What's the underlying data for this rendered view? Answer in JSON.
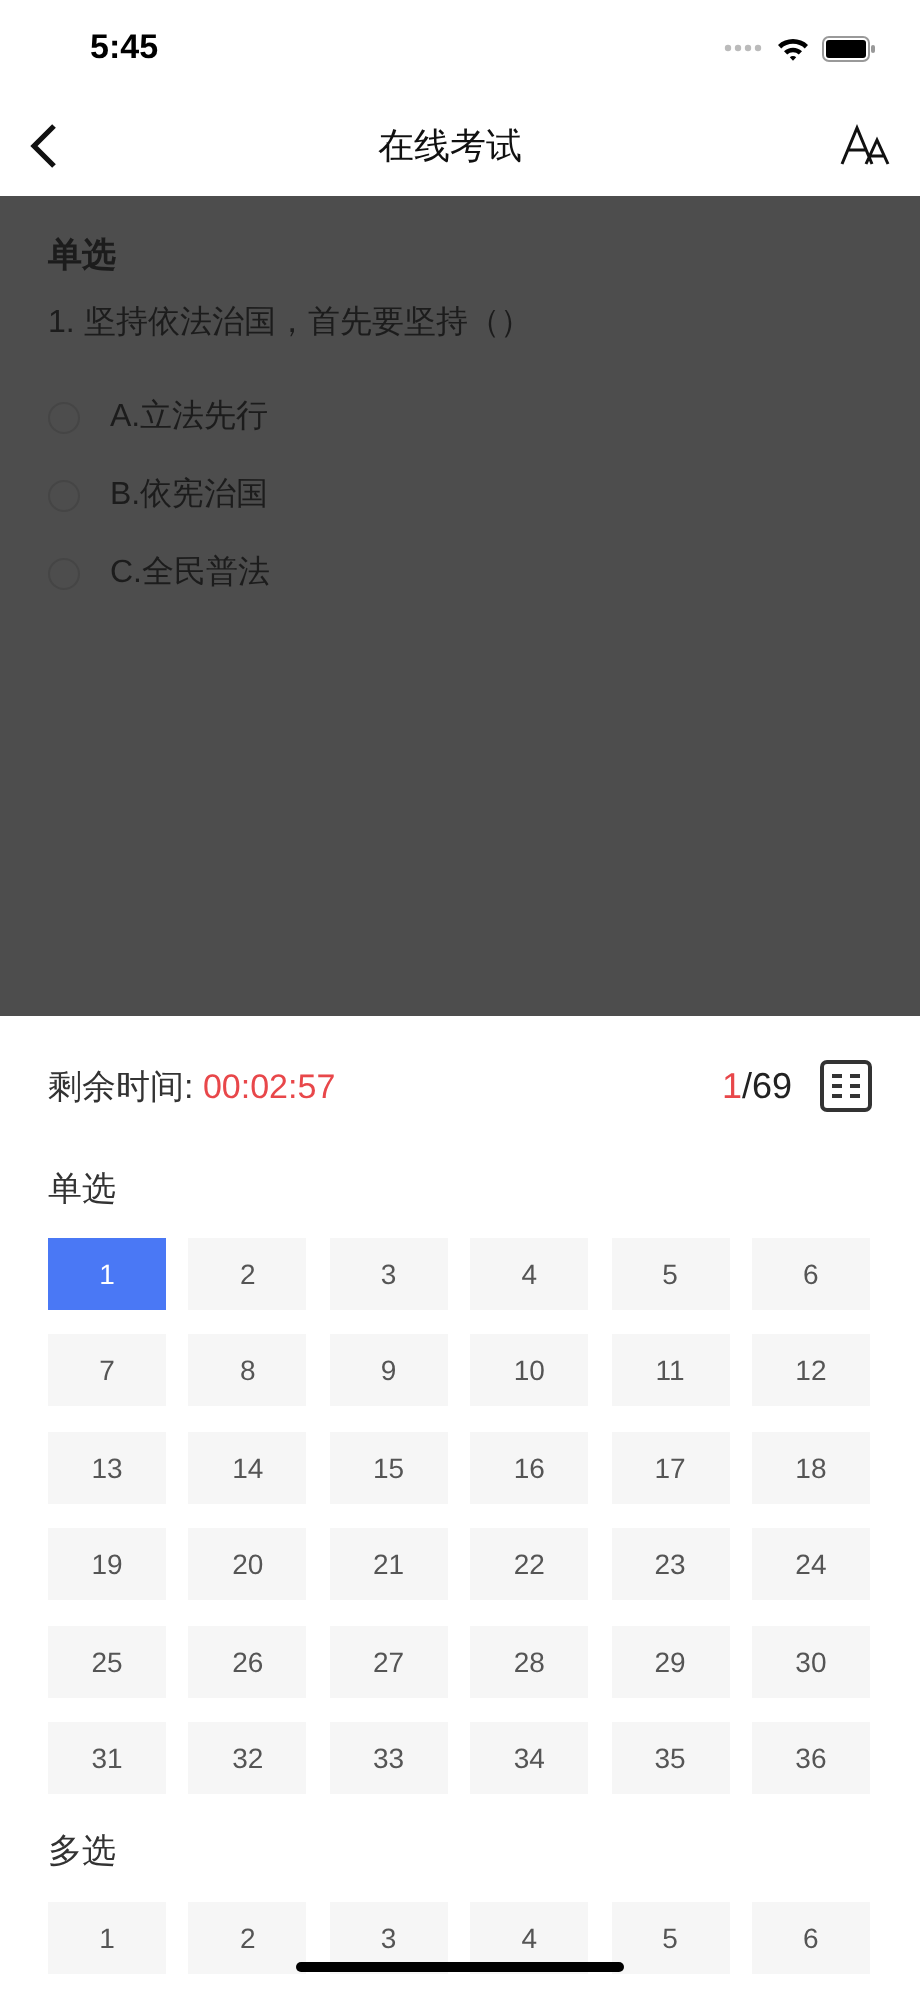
{
  "status_bar": {
    "time": "5:45"
  },
  "nav": {
    "title": "在线考试"
  },
  "question": {
    "type_label": "单选",
    "text": "1. 坚持依法治国，首先要坚持（）",
    "options": [
      {
        "label": "A.立法先行",
        "selected": false
      },
      {
        "label": "B.依宪治国",
        "selected": false
      },
      {
        "label": "C.全民普法",
        "selected": false
      }
    ]
  },
  "answer_sheet": {
    "timer_label": "剩余时间:",
    "timer_value": "00:02:57",
    "current": "1",
    "total": "/69",
    "sections": [
      {
        "title": "单选",
        "items": [
          {
            "label": "1",
            "selected": true
          },
          {
            "label": "2",
            "selected": false
          },
          {
            "label": "3",
            "selected": false
          },
          {
            "label": "4",
            "selected": false
          },
          {
            "label": "5",
            "selected": false
          },
          {
            "label": "6",
            "selected": false
          },
          {
            "label": "7",
            "selected": false
          },
          {
            "label": "8",
            "selected": false
          },
          {
            "label": "9",
            "selected": false
          },
          {
            "label": "10",
            "selected": false
          },
          {
            "label": "11",
            "selected": false
          },
          {
            "label": "12",
            "selected": false
          },
          {
            "label": "13",
            "selected": false
          },
          {
            "label": "14",
            "selected": false
          },
          {
            "label": "15",
            "selected": false
          },
          {
            "label": "16",
            "selected": false
          },
          {
            "label": "17",
            "selected": false
          },
          {
            "label": "18",
            "selected": false
          },
          {
            "label": "19",
            "selected": false
          },
          {
            "label": "20",
            "selected": false
          },
          {
            "label": "21",
            "selected": false
          },
          {
            "label": "22",
            "selected": false
          },
          {
            "label": "23",
            "selected": false
          },
          {
            "label": "24",
            "selected": false
          },
          {
            "label": "25",
            "selected": false
          },
          {
            "label": "26",
            "selected": false
          },
          {
            "label": "27",
            "selected": false
          },
          {
            "label": "28",
            "selected": false
          },
          {
            "label": "29",
            "selected": false
          },
          {
            "label": "30",
            "selected": false
          },
          {
            "label": "31",
            "selected": false
          },
          {
            "label": "32",
            "selected": false
          },
          {
            "label": "33",
            "selected": false
          },
          {
            "label": "34",
            "selected": false
          },
          {
            "label": "35",
            "selected": false
          },
          {
            "label": "36",
            "selected": false
          }
        ]
      },
      {
        "title": "多选",
        "items": [
          {
            "label": "1",
            "selected": false
          },
          {
            "label": "2",
            "selected": false
          },
          {
            "label": "3",
            "selected": false
          },
          {
            "label": "4",
            "selected": false
          },
          {
            "label": "5",
            "selected": false
          },
          {
            "label": "6",
            "selected": false
          }
        ]
      }
    ]
  }
}
